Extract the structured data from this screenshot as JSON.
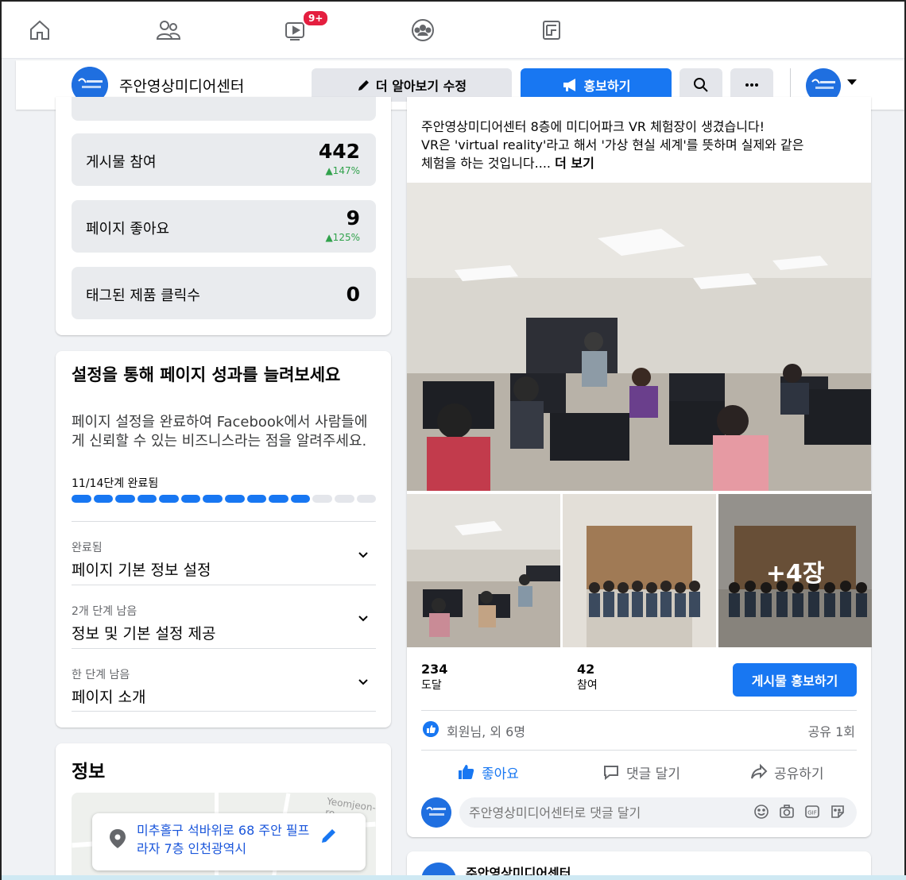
{
  "nav": {
    "notification_badge": "9+",
    "icons": [
      "home-icon",
      "friends-icon",
      "watch-icon",
      "groups-icon",
      "pages-icon"
    ]
  },
  "page_bar": {
    "avatar_text": "주안영상\n미디어센터",
    "page_name": "주안영상미디어센터",
    "edit_button": "더 알아보기 수정",
    "promote_button": "홍보하기"
  },
  "stats": [
    {
      "label": "게시물 참여",
      "value": "442",
      "change": "▲147%"
    },
    {
      "label": "페이지 좋아요",
      "value": "9",
      "change": "▲125%"
    },
    {
      "label": "태그된 제품 클릭수",
      "value": "0",
      "change": ""
    }
  ],
  "setup": {
    "title": "설정을 통해 페이지 성과를 늘려보세요",
    "description": "페이지 설정을 완료하여 Facebook에서 사람들에게 신뢰할 수 있는 비즈니스라는 점을 알려주세요.",
    "progress_label": "11/14단계 완료됨",
    "progress_done": 11,
    "progress_total": 14,
    "items": [
      {
        "status": "완료됨",
        "name": "페이지 기본 정보 설정"
      },
      {
        "status": "2개 단계 남음",
        "name": "정보 및 기본 설정 제공"
      },
      {
        "status": "한 단계 남음",
        "name": "페이지 소개"
      }
    ]
  },
  "info": {
    "title": "정보",
    "map_label": "Yeomjeon-ro",
    "address": "미추홀구 석바위로 68 주안 필프라자 7층 인천광역시"
  },
  "post": {
    "text_line1": "주안영상미디어센터 8층에 미디어파크 VR 체험장이 생겼습니다!",
    "text_line2": "VR은 'virtual reality'라고 해서 '가상 현실 세계'를 뜻하며 실제와 같은",
    "text_line3": "체험을 하는 것입니다....",
    "see_more": "더 보기",
    "more_photos": "+4장",
    "reach_value": "234",
    "reach_label": "도달",
    "engagement_value": "42",
    "engagement_label": "참여",
    "boost_button": "게시물 홍보하기",
    "reactions_text": "회원님, 외 6명",
    "share_count": "공유 1회",
    "like_label": "좋아요",
    "comment_label": "댓글 달기",
    "share_label": "공유하기",
    "comment_placeholder": "주안영상미디어센터로 댓글 달기"
  },
  "next_post": {
    "page_name": "주안영상미디어센터"
  },
  "colors": {
    "accent": "#1877f2",
    "badge": "#e41e3f",
    "positive": "#31a24c"
  }
}
